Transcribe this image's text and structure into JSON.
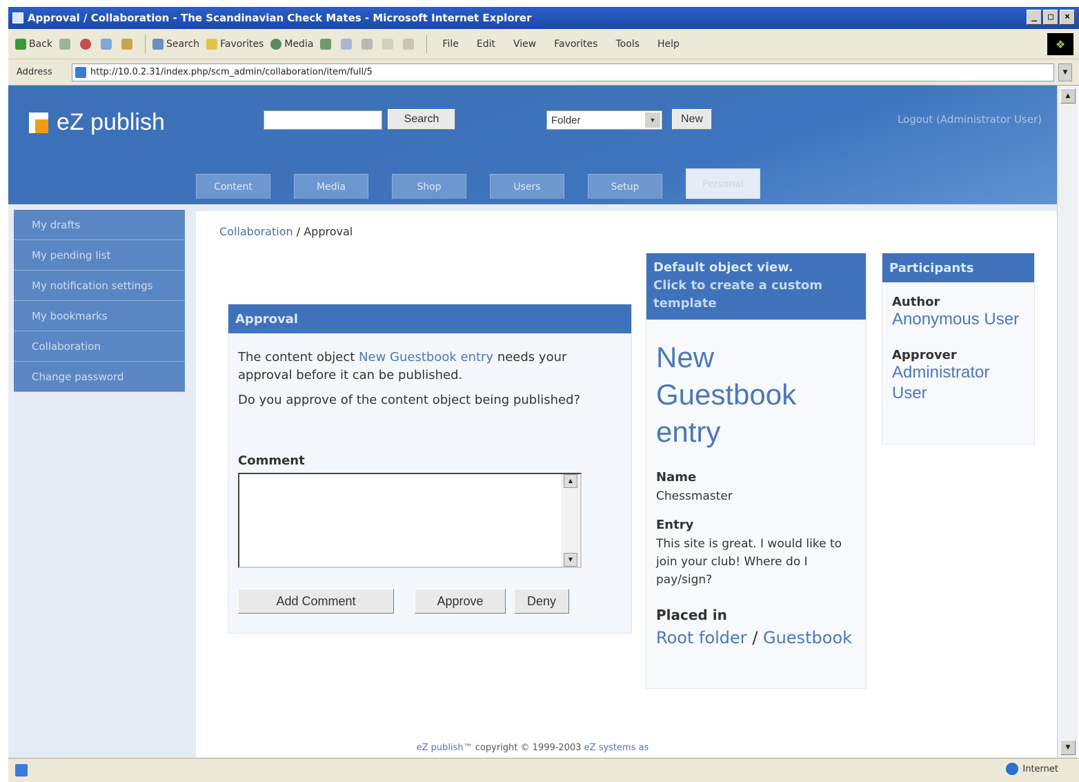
{
  "browser": {
    "title": "Approval / Collaboration - The Scandinavian Check Mates - Microsoft Internet Explorer",
    "window_buttons": [
      "_",
      "□",
      "×"
    ],
    "toolbar": [
      "Back",
      "Search",
      "Favorites",
      "Media"
    ],
    "menu": [
      "File",
      "Edit",
      "View",
      "Favorites",
      "Tools",
      "Help"
    ],
    "address_label": "Address",
    "address_url": "http://10.0.2.31/index.php/scm_admin/collaboration/item/full/5",
    "status_zone": "Internet"
  },
  "header": {
    "logo_text": "eZ publish",
    "search_button": "Search",
    "class_select": "Folder",
    "new_button": "New",
    "logout": "Logout (Administrator User)"
  },
  "tabs": [
    {
      "label": "Content",
      "active": false
    },
    {
      "label": "Media",
      "active": false
    },
    {
      "label": "Shop",
      "active": false
    },
    {
      "label": "Users",
      "active": false
    },
    {
      "label": "Setup",
      "active": false
    },
    {
      "label": "Personal",
      "active": true
    }
  ],
  "sidebar": {
    "items": [
      {
        "label": "My drafts"
      },
      {
        "label": "My pending list"
      },
      {
        "label": "My notification settings"
      },
      {
        "label": "My bookmarks"
      },
      {
        "label": "Collaboration"
      },
      {
        "label": "Change password"
      }
    ]
  },
  "breadcrumb": {
    "link": "Collaboration",
    "separator": "/",
    "current": "Approval"
  },
  "approval": {
    "title": "Approval",
    "text_before": "The content object",
    "object_link": "New Guestbook entry",
    "text_after": "needs your approval before it can be published.",
    "question": "Do you approve of the content object being published?",
    "comment_label": "Comment",
    "add_comment_button": "Add Comment",
    "approve_button": "Approve",
    "deny_button": "Deny"
  },
  "object_view": {
    "header_line1": "Default object view.",
    "header_link": "Click to create a custom template",
    "title": "New Guestbook entry",
    "name_label": "Name",
    "name_value": "Chessmaster",
    "entry_label": "Entry",
    "entry_value": "This site is great. I would like to join your club! Where do I pay/sign?",
    "placed_label": "Placed in",
    "placed_root": "Root folder",
    "placed_separator": "/",
    "placed_leaf": "Guestbook"
  },
  "participants": {
    "title": "Participants",
    "author_label": "Author",
    "author_user": "Anonymous User",
    "approver_label": "Approver",
    "approver_user": "Administrator User"
  },
  "footer": {
    "brand": "eZ publish™",
    "copyright": "copyright © 1999-2003",
    "company": "eZ systems as"
  },
  "colors": {
    "brand_blue": "#3f72bb",
    "link_blue": "#4b78b9",
    "logo_orange": "#f39c12"
  }
}
